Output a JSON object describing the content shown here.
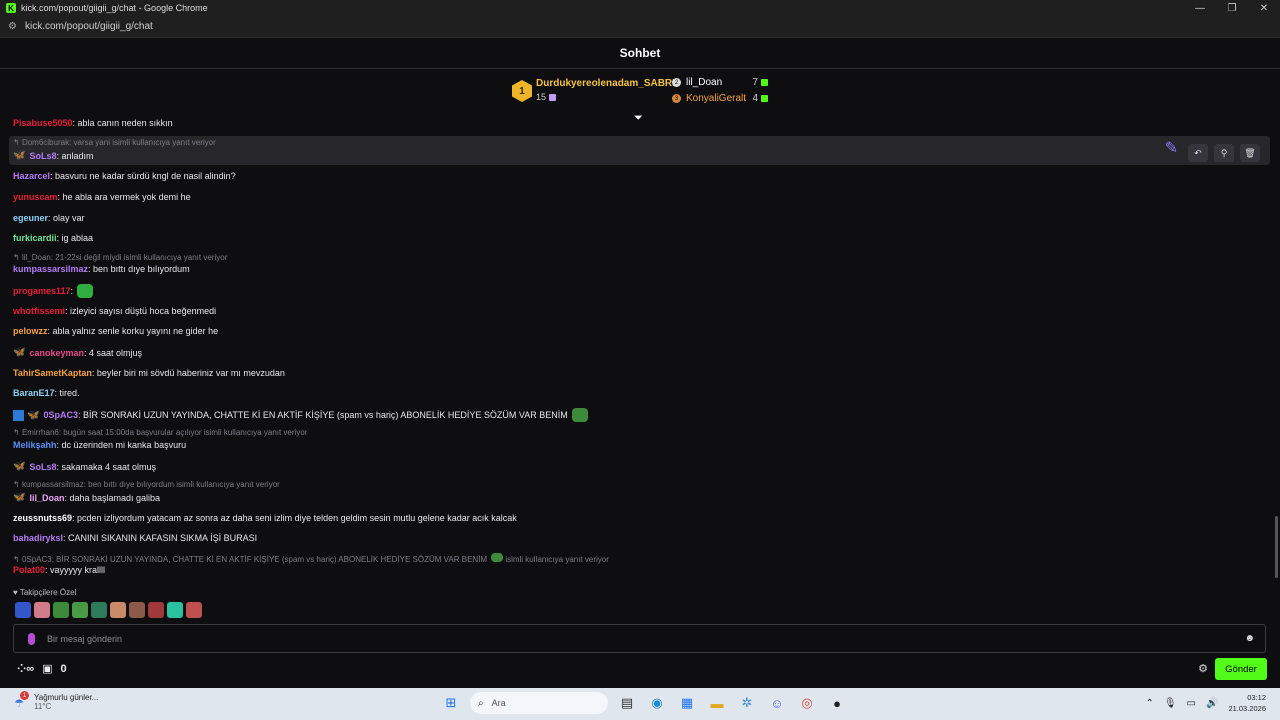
{
  "window": {
    "title": "kick.com/popout/giigii_g/chat - Google Chrome",
    "url": "kick.com/popout/giigii_g/chat"
  },
  "chat": {
    "title": "Sohbet"
  },
  "leaderboard": {
    "first": {
      "rank": "1",
      "name": "Durdukyereolenadam_SABRI",
      "count": "15"
    },
    "second": {
      "name": "lil_Doan",
      "count": "7"
    },
    "third": {
      "name": "KonyaliGeralt",
      "count": "4"
    }
  },
  "messages": [
    {
      "user": "Pisabuse5050",
      "text": ": abla canın neden sıkkın",
      "color": "#e91e3a"
    },
    {
      "reply": "Dom6ciburak: varsa yani isimli kullanıcıya yanıt veriyor",
      "user": "SoLs8",
      "text": ": anladım",
      "color": "#b57bf5"
    },
    {
      "user": "Hazarcel",
      "text": ": basvuru ne kadar sürdü kngl de nasil alindin?",
      "color": "#b57bf5"
    },
    {
      "user": "yunuscam",
      "text": ": he abla ara vermek yok demi he",
      "color": "#e91e3a"
    },
    {
      "user": "egeuner",
      "text": ": olay var",
      "color": "#8ed0f5"
    },
    {
      "user": "furkicardii",
      "text": ": ig ablaa",
      "color": "#6fe39a"
    },
    {
      "reply": "lil_Doan: 21-22si değil miydi isimli kullanıcıya yanıt veriyor",
      "user": "kumpassarsilmaz",
      "text": ": ben bıttı dıye bılıyordum",
      "color": "#b57bf5"
    },
    {
      "user": "progames117",
      "text": ":",
      "color": "#e91e3a"
    },
    {
      "user": "whotfissemi",
      "text": ": izleyici sayısı düştü hoca beğenmedi",
      "color": "#e91e3a"
    },
    {
      "user": "pelowzz",
      "text": ": abla yalnız senle korku yayını ne gider he",
      "color": "#f5a142"
    },
    {
      "user": "canokeyman",
      "text": ": 4 saat olmjuş",
      "color": "#e84a8a"
    },
    {
      "user": "TahirSametKaptan",
      "text": ": beyler biri mi sövdü haberiniz var mı mevzudan",
      "color": "#f5a142"
    },
    {
      "user": "BaranE17",
      "text": ": tired.",
      "color": "#8ed0f5"
    },
    {
      "user": "0SpAC3",
      "text": ": BİR SONRAKİ UZUN YAYINDA, CHATTE Kİ EN AKTİF KİŞİYE (spam vs hariç) ABONELİK HEDİYE SÖZÜM VAR BENİM",
      "color": "#b57bf5"
    },
    {
      "reply": "Emirrhan6: bugün saat 15:00da başvurular açılıyor isimli kullanıcıya yanıt veriyor",
      "user": "Melikşahh",
      "text": ": dc üzerinden mi kanka başvuru",
      "color": "#5a8ff5"
    },
    {
      "user": "SoLs8",
      "text": ": sakamaka 4 saat olmuş",
      "color": "#b57bf5"
    },
    {
      "reply": "kumpassarsilmaz: ben bıttı dıye bılıyordum isimli kullanıcıya yanıt veriyor",
      "user": "lil_Doan",
      "text": ": daha başlamadı galiba",
      "color": "#e6a3f5"
    },
    {
      "user": "zeussnutss69",
      "text": ": pcden izliyordum yatacam az sonra az daha seni izlim diye telden geldim sesin mutlu gelene kadar acık kalcak",
      "color": "#ffffff"
    },
    {
      "user": "bahadiryksl",
      "text": ": CANINI SIKANIN KAFASIN SIKMA İŞİ BURASI",
      "color": "#b57bf5"
    },
    {
      "reply": "0SpAC3: BİR SONRAKİ UZUN YAYINDA, CHATTE Kİ EN AKTİF KİŞİYE (spam vs hariç) ABONELİK HEDİYE SÖZÜM VAR BENİM",
      "reply_suffix": "isimli kullanıcıya yanıt veriyor",
      "user": "Polat00",
      "text": ": vayyyyy krallll",
      "color": "#e91e3a"
    }
  ],
  "follower_only": "Takipçilere Özel",
  "input": {
    "placeholder": "Bir mesaj gönderin"
  },
  "bottom": {
    "count": "0",
    "send_label": "Gönder"
  },
  "taskbar": {
    "weather_title": "Yağmurlu günler...",
    "weather_temp": "11°C",
    "weather_badge": "1",
    "search_label": "Ara",
    "time": "03:12",
    "date": "21.03.2026"
  },
  "colors": {
    "accent": "#53fc18",
    "background": "#0e0e10",
    "highlight_row": "#26262b"
  }
}
